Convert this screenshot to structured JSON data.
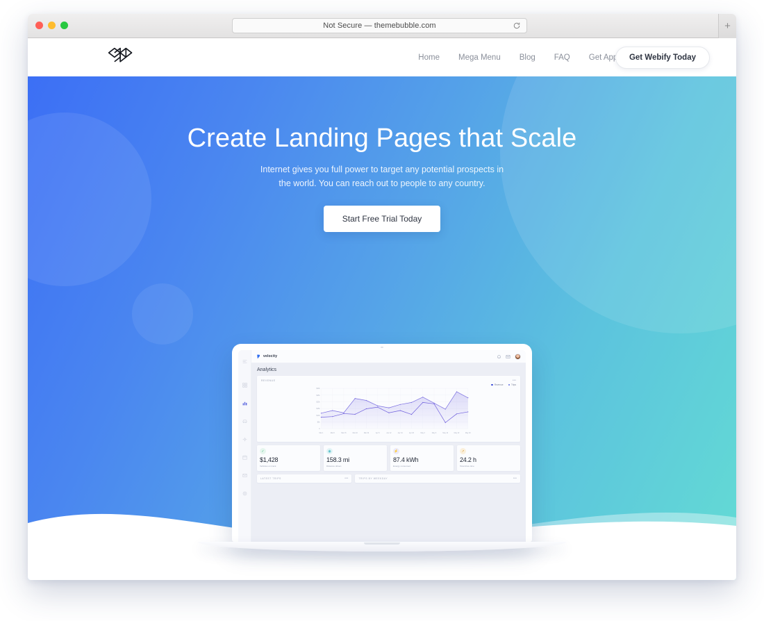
{
  "browser": {
    "url_text": "Not Secure — themebubble.com",
    "reload_icon": "reload-icon",
    "newtab_label": "+",
    "traffic_lights": [
      "close",
      "minimize",
      "maximize"
    ]
  },
  "site_nav": {
    "logo_name": "webify-logo",
    "links": [
      {
        "label": "Home"
      },
      {
        "label": "Mega Menu"
      },
      {
        "label": "Blog"
      },
      {
        "label": "FAQ"
      },
      {
        "label": "Get App Today"
      }
    ],
    "cta_label": "Get Webify Today"
  },
  "hero": {
    "headline": "Create Landing Pages that Scale",
    "subtitle_line1": "Internet gives you full power to target any potential prospects in",
    "subtitle_line2": "the world. You can reach out to people to any country.",
    "cta_label": "Start Free Trial Today",
    "gradient_start": "#3c6ff5",
    "gradient_end": "#63dbd4"
  },
  "dashboard": {
    "brand": "velocity",
    "page_title": "Analytics",
    "top_icons": [
      "bell-icon",
      "mail-icon",
      "avatar"
    ],
    "sidebar_icons": [
      "menu-icon",
      "grid-icon",
      "analytics-icon",
      "car-icon",
      "route-icon",
      "calendar-icon",
      "inbox-icon",
      "settings-icon"
    ],
    "chart_card_label": "REVENUE",
    "stats": [
      {
        "value": "$1,428",
        "label": "Vehicles on track",
        "icon": "check-icon",
        "color": "#53c08a",
        "bg": "#e6f6ee"
      },
      {
        "value": "158.3 mi",
        "label": "Distance driven",
        "icon": "location-icon",
        "color": "#49b9c4",
        "bg": "#e2f4f6"
      },
      {
        "value": "87.4 kWh",
        "label": "Energy consumed",
        "icon": "bolt-icon",
        "color": "#8271d8",
        "bg": "#eceafa"
      },
      {
        "value": "24.2 h",
        "label": "Total drive time",
        "icon": "trend-icon",
        "color": "#e0a64b",
        "bg": "#fbf0db"
      }
    ],
    "panels": [
      {
        "label": "LATEST TRIPS",
        "menu": "more-icon"
      },
      {
        "label": "TRIPS BY WEEKDAY",
        "menu": "more-icon"
      }
    ]
  },
  "chart_data": {
    "type": "line",
    "title": "REVENUE",
    "xlabel": "",
    "ylabel": "",
    "grid": true,
    "legend_position": "top-right",
    "ylim": [
      0,
      30000
    ],
    "ytick_labels": [
      "0",
      "$5k",
      "$10k",
      "$15k",
      "$20k",
      "$25k",
      "$30k"
    ],
    "ytick_values": [
      0,
      5000,
      10000,
      15000,
      20000,
      25000,
      30000
    ],
    "categories": [
      "Mar 1",
      "Mar 8",
      "Mar 15",
      "Mar 22",
      "Mar 29",
      "Apr 5",
      "Apr 12",
      "Apr 19",
      "Apr 26",
      "May 2",
      "May 9",
      "May 16",
      "May 23",
      "May 30"
    ],
    "series": [
      {
        "name": "Revenue",
        "color": "#7b6fe0",
        "values": [
          11500,
          13500,
          11800,
          22500,
          21000,
          17000,
          15500,
          18000,
          19500,
          23500,
          19000,
          14500,
          27500,
          23000
        ]
      },
      {
        "name": "Trips",
        "color": "#6f5fdc",
        "values": [
          8500,
          9000,
          11200,
          10700,
          14800,
          16000,
          11800,
          13500,
          10600,
          19500,
          18500,
          4500,
          11000,
          12500
        ]
      }
    ]
  }
}
